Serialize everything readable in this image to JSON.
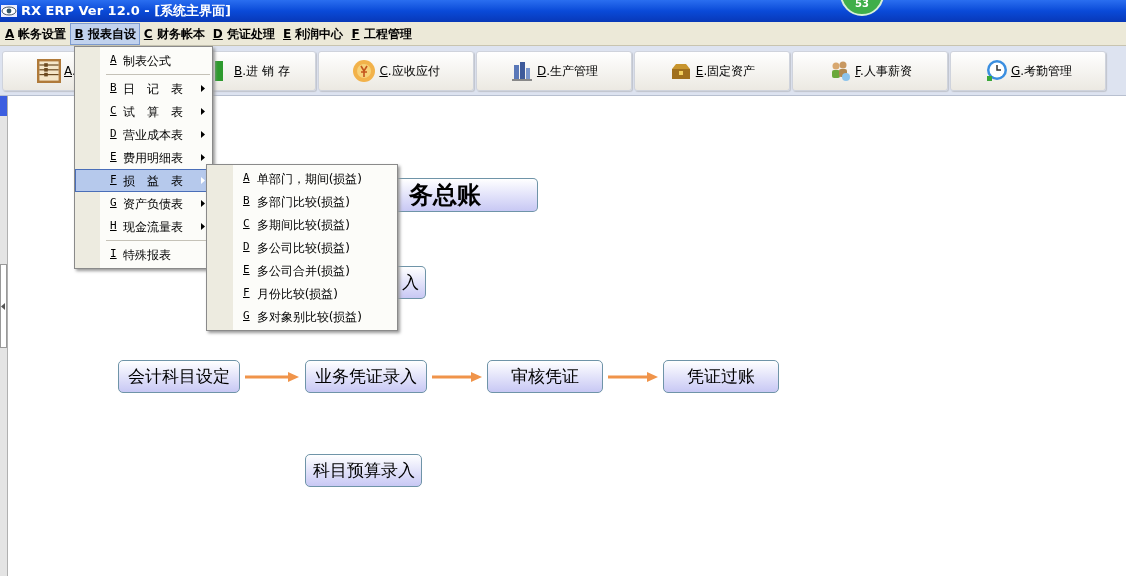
{
  "window": {
    "title": "RX ERP Ver 12.0 - [系统主界面]"
  },
  "notification_badge": "53",
  "menu_bar": [
    {
      "key": "A",
      "label": "帐务设置",
      "selected": false
    },
    {
      "key": "B",
      "label": "报表自设",
      "selected": true
    },
    {
      "key": "C",
      "label": "财务帐本",
      "selected": false
    },
    {
      "key": "D",
      "label": "凭证处理",
      "selected": false
    },
    {
      "key": "E",
      "label": "利润中心",
      "selected": false
    },
    {
      "key": "F",
      "label": "工程管理",
      "selected": false
    }
  ],
  "open_menu": {
    "items": [
      {
        "kind": "item",
        "key": "A",
        "label": "制表公式",
        "submenu": false,
        "selected": false
      },
      {
        "kind": "separator"
      },
      {
        "kind": "item",
        "key": "B",
        "label": "日　记　表",
        "submenu": true,
        "selected": false
      },
      {
        "kind": "item",
        "key": "C",
        "label": "试　算　表",
        "submenu": true,
        "selected": false
      },
      {
        "kind": "item",
        "key": "D",
        "label": "营业成本表",
        "submenu": true,
        "selected": false
      },
      {
        "kind": "item",
        "key": "E",
        "label": "费用明细表",
        "submenu": true,
        "selected": false
      },
      {
        "kind": "item",
        "key": "F",
        "label": "损　益　表",
        "submenu": true,
        "selected": true
      },
      {
        "kind": "item",
        "key": "G",
        "label": "资产负债表",
        "submenu": true,
        "selected": false
      },
      {
        "kind": "item",
        "key": "H",
        "label": "现金流量表",
        "submenu": true,
        "selected": false
      },
      {
        "kind": "separator"
      },
      {
        "kind": "item",
        "key": "I",
        "label": "特殊报表",
        "submenu": false,
        "selected": false
      }
    ]
  },
  "submenu": {
    "items": [
      {
        "key": "A",
        "label": "单部门，期间(损益)"
      },
      {
        "key": "B",
        "label": "多部门比较(损益)"
      },
      {
        "key": "C",
        "label": "多期间比较(损益)"
      },
      {
        "key": "D",
        "label": "多公司比较(损益)"
      },
      {
        "key": "E",
        "label": "多公司合并(损益)"
      },
      {
        "key": "F",
        "label": "月份比较(损益)"
      },
      {
        "key": "G",
        "label": "多对象别比较(损益)"
      }
    ]
  },
  "toolbar": [
    {
      "key": "A",
      "label": "."
    },
    {
      "key": "B",
      "label": ".进 销 存"
    },
    {
      "key": "C",
      "label": ".应收应付"
    },
    {
      "key": "D",
      "label": ".生产管理"
    },
    {
      "key": "E",
      "label": ".固定资产"
    },
    {
      "key": "F",
      "label": ".人事薪资"
    },
    {
      "key": "G",
      "label": ".考勤管理"
    }
  ],
  "flowchart": {
    "nodes": [
      {
        "kind": "title",
        "label": "务总账"
      },
      {
        "kind": "step",
        "label": "入"
      },
      {
        "kind": "step",
        "label": "会计科目设定"
      },
      {
        "kind": "step",
        "label": "业务凭证录入"
      },
      {
        "kind": "step",
        "label": "审核凭证"
      },
      {
        "kind": "step",
        "label": "凭证过账"
      },
      {
        "kind": "step",
        "label": "科目预算录入"
      }
    ]
  }
}
